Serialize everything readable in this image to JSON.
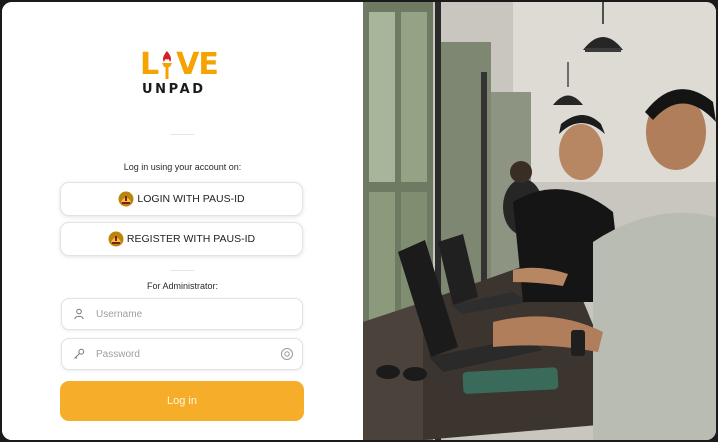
{
  "brand": {
    "logo_word_left": "L",
    "logo_word_right": "VE",
    "logo_sub": "UNPAD"
  },
  "sso": {
    "caption": "Log in using your account on:",
    "login_label": "LOGIN WITH PAUS-ID",
    "register_label": "REGISTER WITH PAUS-ID"
  },
  "admin": {
    "caption": "For Administrator:",
    "username_placeholder": "Username",
    "password_placeholder": "Password",
    "submit_label": "Log in"
  },
  "colors": {
    "accent": "#f6ad2a",
    "logo": "#f5a300",
    "torch_flame": "#d7201f"
  },
  "icons": [
    "torch-icon",
    "unpad-seal-icon",
    "user-icon",
    "key-icon",
    "eye-icon"
  ]
}
